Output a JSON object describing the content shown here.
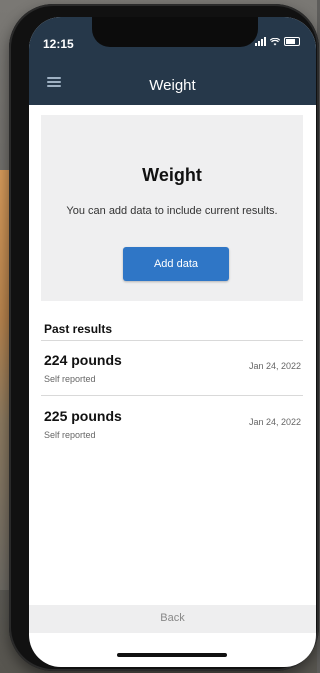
{
  "status_bar": {
    "time": "12:15"
  },
  "header": {
    "title": "Weight"
  },
  "card": {
    "title": "Weight",
    "description": "You can add data to include current results.",
    "add_button_label": "Add data"
  },
  "past_results": {
    "heading": "Past results",
    "items": [
      {
        "value": "224 pounds",
        "source": "Self reported",
        "date": "Jan 24, 2022"
      },
      {
        "value": "225 pounds",
        "source": "Self reported",
        "date": "Jan 24, 2022"
      }
    ]
  },
  "footer": {
    "back_label": "Back"
  },
  "colors": {
    "header_bg": "#26384a",
    "primary_button": "#2f76c6",
    "card_bg": "#efeff0"
  },
  "icons": [
    "menu-icon",
    "signal-icon",
    "wifi-icon",
    "battery-icon"
  ]
}
